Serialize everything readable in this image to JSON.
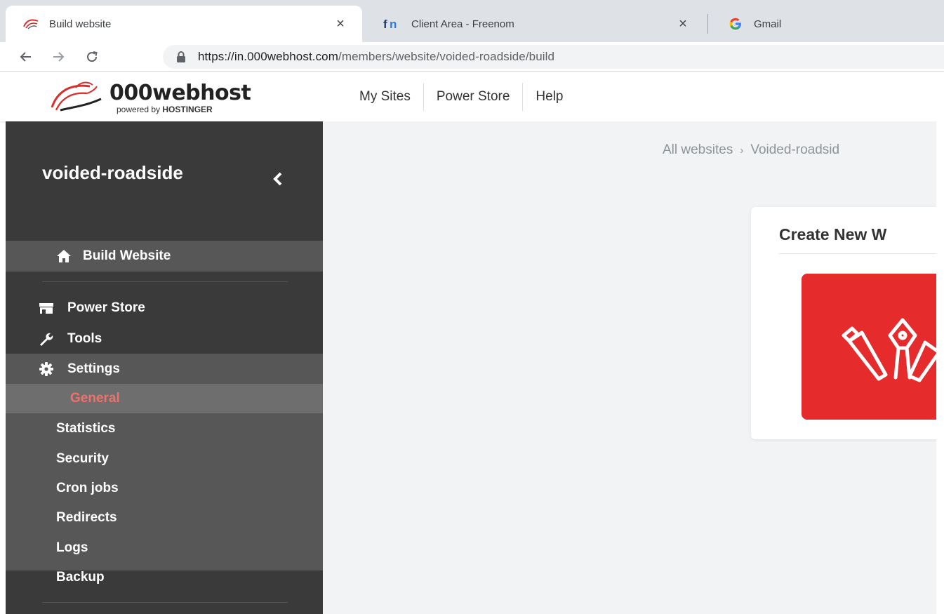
{
  "browser": {
    "tabs": [
      {
        "title": "Build website",
        "favicon": "000webhost-swirl-icon",
        "close": "×",
        "active": true
      },
      {
        "title": "Client Area - Freenom",
        "favicon": "freenom-fn-icon",
        "close": "×",
        "active": false
      },
      {
        "title": "Gmail",
        "favicon": "google-g-icon",
        "active": false
      }
    ],
    "address": {
      "host": "https://in.000webhost.com",
      "path": "/members/website/voided-roadside/build"
    }
  },
  "header": {
    "logo": {
      "brand": "000webhost",
      "powered_prefix": "powered by ",
      "powered_brand": "HOSTINGER"
    },
    "nav": [
      "My Sites",
      "Power Store",
      "Help"
    ]
  },
  "sidebar": {
    "site_name": "voided-roadside",
    "build_label": "Build Website",
    "items": [
      {
        "label": "Power Store",
        "icon": "store-icon"
      },
      {
        "label": "Tools",
        "icon": "wrench-icon"
      },
      {
        "label": "Settings",
        "icon": "gear-icon"
      }
    ],
    "settings_submenu": {
      "active": "General",
      "items": [
        "Statistics",
        "Security",
        "Cron jobs",
        "Redirects",
        "Logs",
        "Backup"
      ]
    }
  },
  "main": {
    "breadcrumb": {
      "root": "All websites",
      "current": "Voided-roadsid"
    },
    "card": {
      "title": "Create New W",
      "tile_icon": "design-tools-icon"
    }
  },
  "colors": {
    "sidebar_bg": "#3a3a3a",
    "sidebar_active": "#575757",
    "submenu_active": "#6e6e6e",
    "accent_red": "#e52b2b",
    "active_text": "#f0706a",
    "content_bg": "#f1f3f5"
  }
}
